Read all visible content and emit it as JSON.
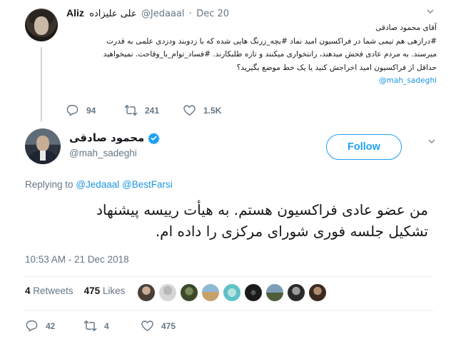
{
  "parent_tweet": {
    "author_name": "Aliz",
    "author_rtl_name": "علی علیزاده",
    "author_handle": "@Jedaaal",
    "separator": "·",
    "date": "Dec 20",
    "lines": [
      "آقای محمود صادقی",
      "#درازهی هم تیمی شما در فراکسیون امید نماد #بچه_زرنگ هایی شده که با زدوبند ودزدی علمی به قدرت",
      "میرسند. به مردم عادی فحش میدهند، رانتخواری میکنند و تازه طلبکارند. #فساد_توام_با_وقاحت. نمیخواهید",
      "حداقل از فراکسیون امید اخراجش کنید یا یک خط موضع بگیرید؟",
      "@mah_sadeghi"
    ],
    "replies": "94",
    "retweets": "241",
    "likes": "1.5K"
  },
  "main_tweet": {
    "author_name": "محمود صادقی",
    "author_handle": "@mah_sadeghi",
    "follow_label": "Follow",
    "replying_label": "Replying to",
    "replying_to": [
      "@Jedaaal",
      "@BestFarsi"
    ],
    "text_lines": [
      "من عضو عادی فراکسیون هستم. به هیأت رییسه پیشنهاد",
      "تشکیل جلسه فوری شورای مرکزی را داده ام."
    ],
    "timestamp": "10:53 AM - 21 Dec 2018",
    "retweet_count": "4",
    "retweet_label": "Retweets",
    "like_count": "475",
    "like_label": "Likes",
    "replies": "42",
    "retweets": "4",
    "likes": "475"
  },
  "colors": {
    "accent": "#1da1f2",
    "link": "#1b95e0",
    "secondary_text": "#657786",
    "divider": "#e6ecf0"
  },
  "icons": {
    "reply": "reply-icon",
    "retweet": "retweet-icon",
    "like": "heart-icon",
    "verified": "verified-badge-icon",
    "caret": "chevron-down-icon"
  }
}
